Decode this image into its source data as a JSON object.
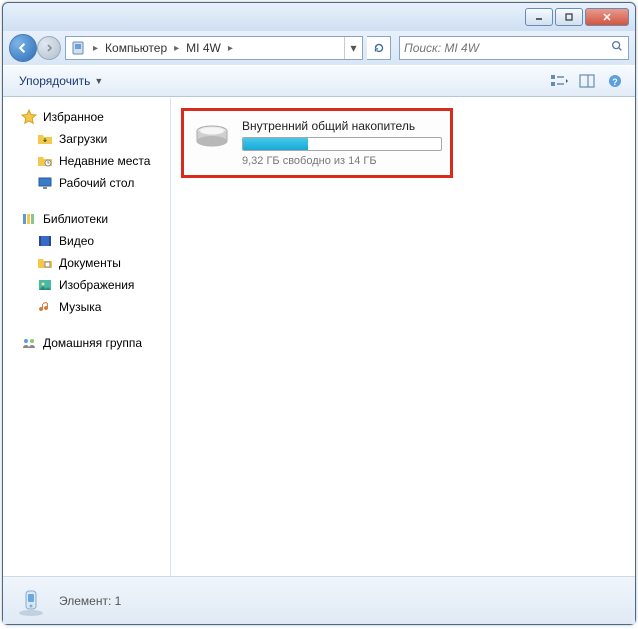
{
  "titlebar": {},
  "nav": {
    "breadcrumbs": [
      "Компьютер",
      "MI 4W"
    ],
    "search_placeholder": "Поиск: MI 4W"
  },
  "toolbar": {
    "organize_label": "Упорядочить"
  },
  "sidebar": {
    "favorites": {
      "header": "Избранное",
      "items": [
        "Загрузки",
        "Недавние места",
        "Рабочий стол"
      ]
    },
    "libraries": {
      "header": "Библиотеки",
      "items": [
        "Видео",
        "Документы",
        "Изображения",
        "Музыка"
      ]
    },
    "homegroup": {
      "header": "Домашняя группа"
    }
  },
  "content": {
    "drive": {
      "name": "Внутренний общий накопитель",
      "free_text": "9,32 ГБ свободно из 14 ГБ",
      "used_percent": 33
    }
  },
  "statusbar": {
    "text": "Элемент: 1"
  }
}
